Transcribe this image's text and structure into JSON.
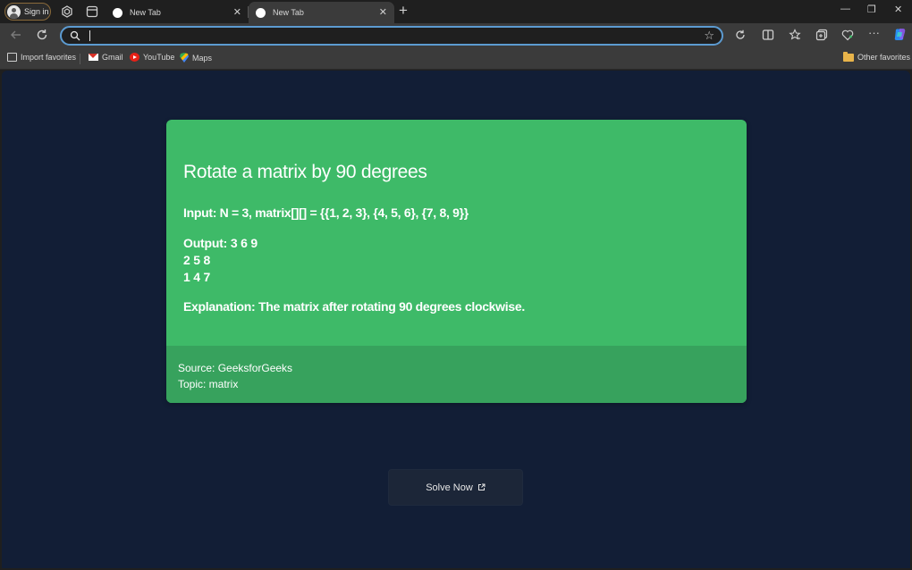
{
  "browser": {
    "profile_label": "Sign in",
    "tabs": [
      {
        "title": "New Tab",
        "close": "✕"
      },
      {
        "title": "New Tab",
        "close": "✕"
      }
    ],
    "new_tab_glyph": "+",
    "window_controls": {
      "minimize": "—",
      "maximize": "❐",
      "close": "✕"
    },
    "address_bar": {
      "value": "",
      "placeholder": ""
    },
    "bookmarks": [
      {
        "label": "Import favorites",
        "icon": "import-icon"
      },
      {
        "label": "Gmail",
        "icon": "gmail-icon"
      },
      {
        "label": "YouTube",
        "icon": "youtube-icon"
      },
      {
        "label": "Maps",
        "icon": "maps-icon"
      }
    ],
    "other_favorites": "Other favorites"
  },
  "problem": {
    "title": "Rotate a matrix by 90 degrees",
    "input": "Input: N = 3, matrix[][] = {{1, 2, 3}, {4, 5, 6}, {7, 8, 9}}",
    "output_lines": [
      "Output: 3 6 9",
      "2 5 8",
      "1 4 7"
    ],
    "explanation": "Explanation: The matrix after rotating 90 degrees clockwise.",
    "source": "Source: GeeksforGeeks",
    "topic": "Topic: matrix"
  },
  "solve_button": {
    "label": "Solve Now"
  },
  "colors": {
    "page_bg": "#121e36",
    "card_bg": "#3eba68",
    "card_footer_bg": "#37a25d",
    "button_bg": "#1c2638",
    "address_focus": "#5c9bd1"
  }
}
